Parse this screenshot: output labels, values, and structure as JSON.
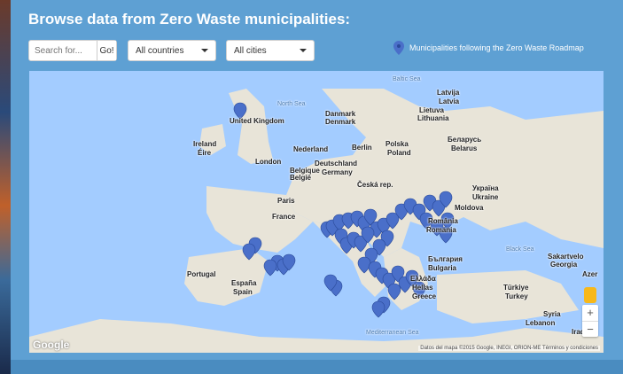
{
  "header": {
    "title": "Browse data from Zero Waste municipalities:"
  },
  "search": {
    "placeholder": "Search for...",
    "button_label": "Go!"
  },
  "filters": {
    "countries_label": "All countries",
    "cities_label": "All cities"
  },
  "legend": {
    "label": "Municipalities following the Zero Waste Roadmap"
  },
  "map": {
    "labels": [
      "North Sea",
      "United Kingdom",
      "Ireland",
      "Éire",
      "London",
      "Nederland",
      "Belgique",
      "België",
      "Deutschland",
      "Germany",
      "Berlin",
      "Danmark",
      "Denmark",
      "Polska",
      "Poland",
      "Česká rep.",
      "France",
      "Paris",
      "España",
      "Spain",
      "Portugal",
      "Беларусь",
      "Belarus",
      "Lietuva",
      "Lithuania",
      "Latvija",
      "Latvia",
      "Baltic Sea",
      "Україна",
      "Ukraine",
      "Moldova",
      "România",
      "Romania",
      "България",
      "Bulgaria",
      "Ελλάδα",
      "Hellas",
      "Greece",
      "Türkiye",
      "Turkey",
      "Black Sea",
      "Sakartvelo",
      "Georgia",
      "Azer",
      "Mediterranean Sea",
      "Lebanon",
      "Iraq",
      "Syria"
    ],
    "google_logo": "Google",
    "attribution": "Datos del mapa ©2015 Google, INEGI, ORION-ME    Términos y condiciones",
    "zoom_in": "+",
    "zoom_out": "−"
  },
  "colors": {
    "panel": "#5ea0d3",
    "sea": "#a3ccff",
    "land": "#e8e4d8",
    "marker": "#4a6fc9"
  }
}
